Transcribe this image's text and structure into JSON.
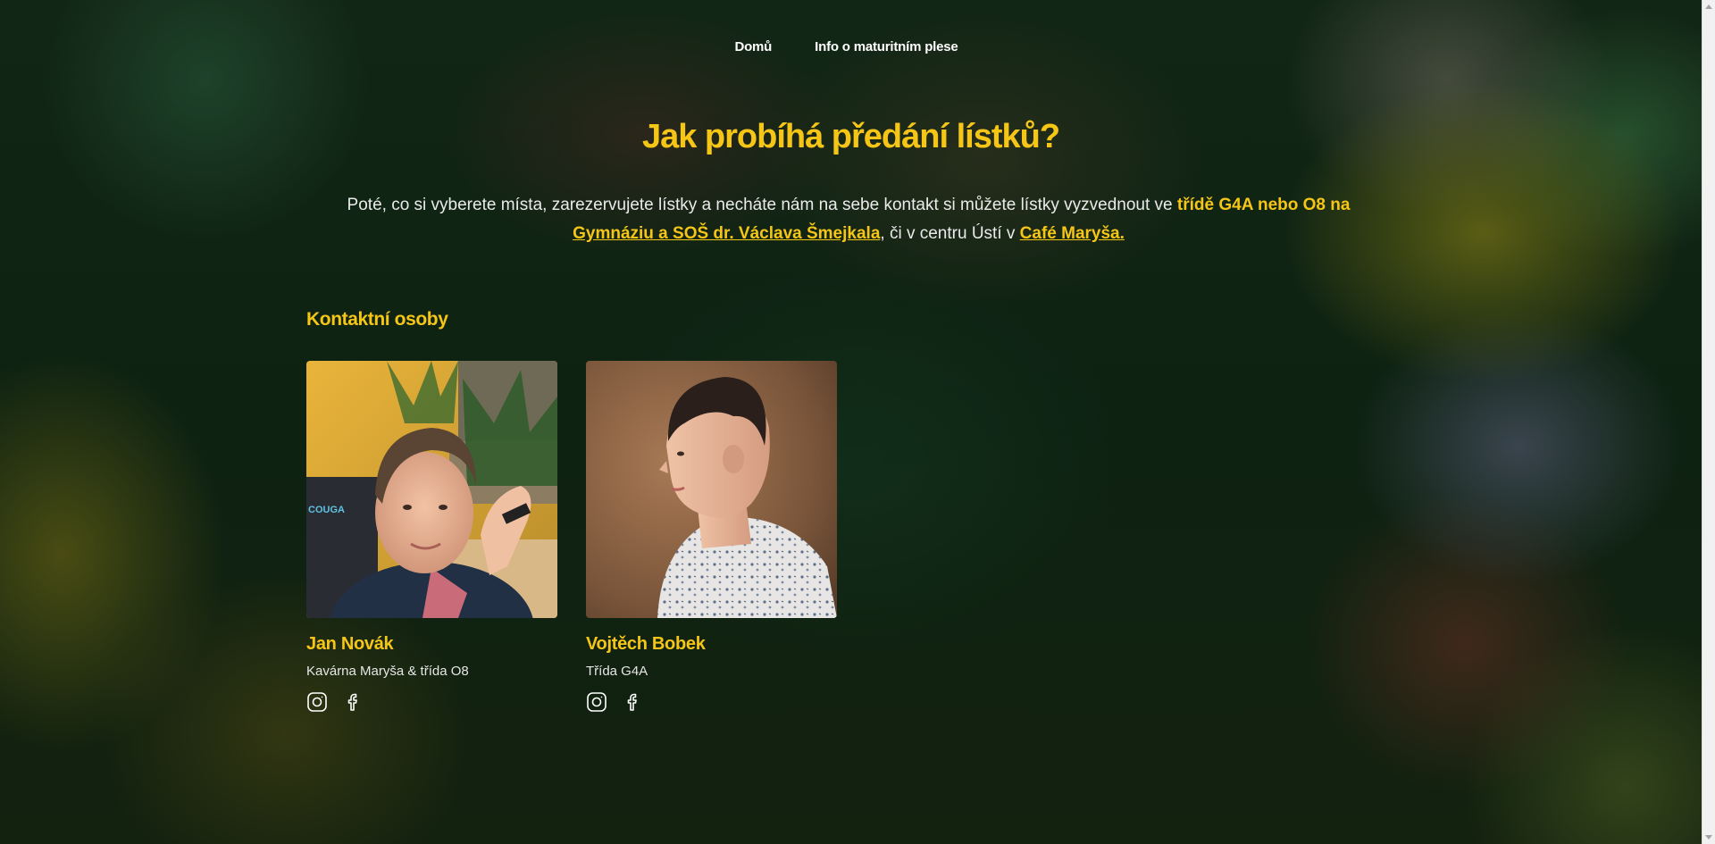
{
  "nav": {
    "items": [
      {
        "label": "Domů"
      },
      {
        "label": "Info o maturitním plese"
      }
    ]
  },
  "hero": {
    "title": "Jak probíhá předání lístků?",
    "intro_text_1": "Poté, co si vyberete místa, zarezervujete lístky a necháte nám na sebe kontakt si můžete lístky vyzvednout ve ",
    "intro_highlight": "třídě G4A nebo O8 na",
    "intro_link_school": "Gymnáziu a SOŠ dr. Václava Šmejkala",
    "intro_text_2": ", či v centru Ústí v ",
    "intro_link_cafe": "Café Maryša."
  },
  "contacts": {
    "heading": "Kontaktní osoby",
    "people": [
      {
        "name": "Jan Novák",
        "role": "Kavárna Maryša & třída O8",
        "photo_alt": "photo",
        "photo_text": "COUGA",
        "icons": [
          "instagram-icon",
          "facebook-icon"
        ]
      },
      {
        "name": "Vojtěch Bobek",
        "role": "Třída G4A",
        "photo_alt": "photo",
        "icons": [
          "instagram-icon",
          "facebook-icon"
        ]
      }
    ]
  },
  "colors": {
    "accent": "#f6c616",
    "text": "#eaeaea",
    "nav_text": "#ffffff"
  }
}
